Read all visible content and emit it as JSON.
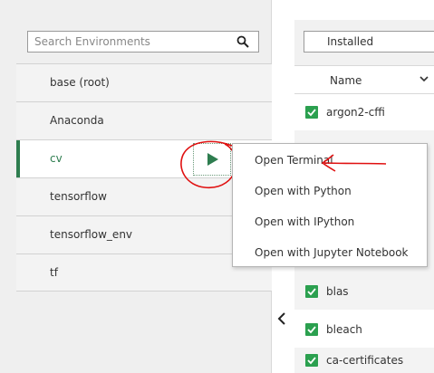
{
  "search": {
    "placeholder": "Search Environments",
    "icon": "search-icon"
  },
  "environments": [
    {
      "label": "base (root)"
    },
    {
      "label": "Anaconda"
    },
    {
      "label": "cv",
      "selected": true
    },
    {
      "label": "tensorflow"
    },
    {
      "label": "tensorflow_env"
    },
    {
      "label": "tf"
    }
  ],
  "packages": {
    "filter_value": "Installed",
    "column_header": "Name",
    "items": [
      {
        "label": "argon2-cffi",
        "checked": true
      },
      {
        "label": "blas",
        "checked": true
      },
      {
        "label": "bleach",
        "checked": true
      },
      {
        "label": "ca-certificates",
        "checked": true
      }
    ]
  },
  "context_menu": {
    "items": [
      {
        "label": "Open Terminal"
      },
      {
        "label": "Open with Python"
      },
      {
        "label": "Open with IPython"
      },
      {
        "label": "Open with Jupyter Notebook"
      }
    ]
  },
  "colors": {
    "accent_green": "#2e7d4f",
    "checkbox_green": "#2ba04f",
    "annotation_red": "#e01010"
  }
}
